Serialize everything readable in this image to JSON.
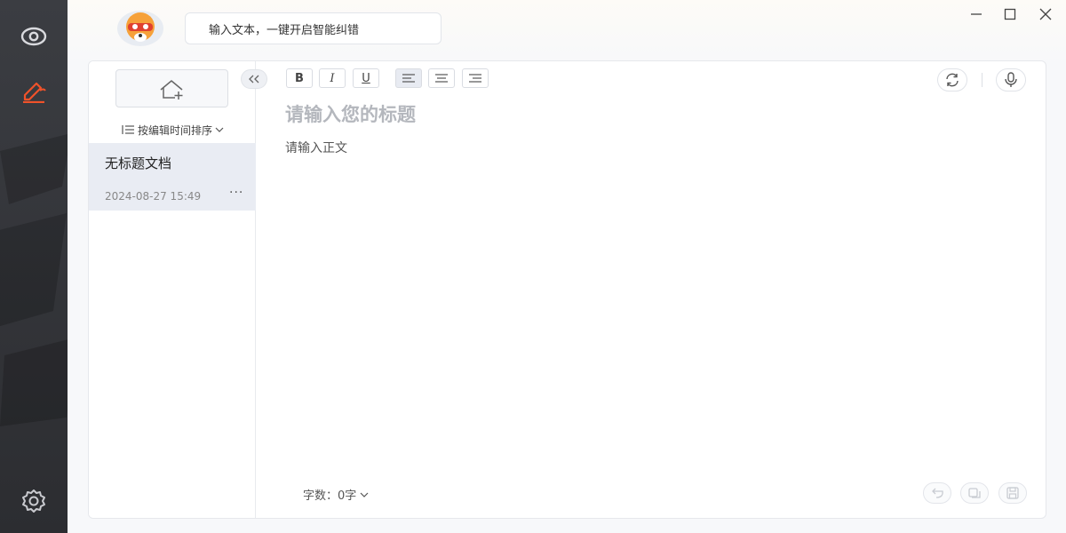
{
  "sidebar": {
    "items": [
      {
        "icon": "eye-icon",
        "active": false
      },
      {
        "icon": "edit-icon",
        "active": true
      },
      {
        "icon": "gear-icon",
        "active": false
      }
    ],
    "accent_color": "#f0522a"
  },
  "window": {
    "controls": [
      "minimize",
      "maximize",
      "close"
    ]
  },
  "header": {
    "bubble_text": "输入文本，一键开启智能纠错"
  },
  "doc_list": {
    "new_button_icon": "add-document-icon",
    "sort_label": "按编辑时间排序",
    "items": [
      {
        "title": "无标题文档",
        "time": "2024-08-27 15:49",
        "selected": true
      }
    ]
  },
  "toolbar": {
    "bold": "B",
    "italic": "I",
    "underline": "U",
    "align_options": [
      "align-left",
      "align-center",
      "align-right"
    ],
    "active_align": "align-left"
  },
  "editor": {
    "title_placeholder": "请输入您的标题",
    "body_placeholder": "请输入正文"
  },
  "footer": {
    "word_count_label": "字数：0字"
  }
}
